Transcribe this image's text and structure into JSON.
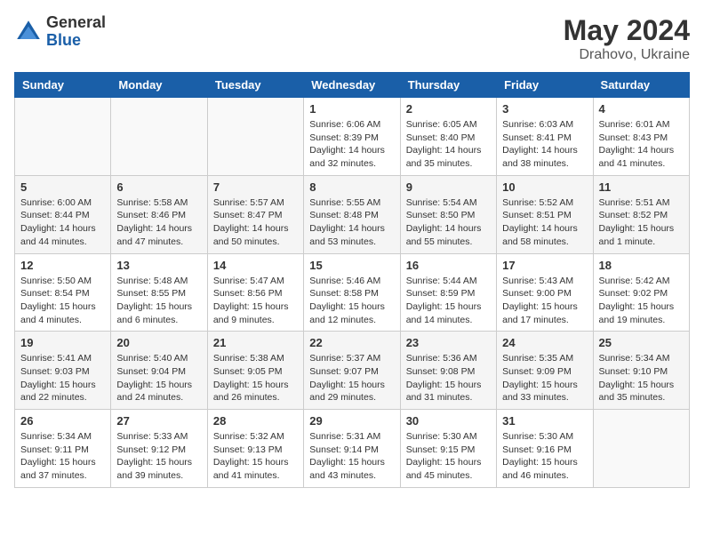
{
  "header": {
    "logo": {
      "general": "General",
      "blue": "Blue"
    },
    "title": "May 2024",
    "location": "Drahovo, Ukraine"
  },
  "weekdays": [
    "Sunday",
    "Monday",
    "Tuesday",
    "Wednesday",
    "Thursday",
    "Friday",
    "Saturday"
  ],
  "weeks": [
    [
      {
        "day": "",
        "info": ""
      },
      {
        "day": "",
        "info": ""
      },
      {
        "day": "",
        "info": ""
      },
      {
        "day": "1",
        "info": "Sunrise: 6:06 AM\nSunset: 8:39 PM\nDaylight: 14 hours\nand 32 minutes."
      },
      {
        "day": "2",
        "info": "Sunrise: 6:05 AM\nSunset: 8:40 PM\nDaylight: 14 hours\nand 35 minutes."
      },
      {
        "day": "3",
        "info": "Sunrise: 6:03 AM\nSunset: 8:41 PM\nDaylight: 14 hours\nand 38 minutes."
      },
      {
        "day": "4",
        "info": "Sunrise: 6:01 AM\nSunset: 8:43 PM\nDaylight: 14 hours\nand 41 minutes."
      }
    ],
    [
      {
        "day": "5",
        "info": "Sunrise: 6:00 AM\nSunset: 8:44 PM\nDaylight: 14 hours\nand 44 minutes."
      },
      {
        "day": "6",
        "info": "Sunrise: 5:58 AM\nSunset: 8:46 PM\nDaylight: 14 hours\nand 47 minutes."
      },
      {
        "day": "7",
        "info": "Sunrise: 5:57 AM\nSunset: 8:47 PM\nDaylight: 14 hours\nand 50 minutes."
      },
      {
        "day": "8",
        "info": "Sunrise: 5:55 AM\nSunset: 8:48 PM\nDaylight: 14 hours\nand 53 minutes."
      },
      {
        "day": "9",
        "info": "Sunrise: 5:54 AM\nSunset: 8:50 PM\nDaylight: 14 hours\nand 55 minutes."
      },
      {
        "day": "10",
        "info": "Sunrise: 5:52 AM\nSunset: 8:51 PM\nDaylight: 14 hours\nand 58 minutes."
      },
      {
        "day": "11",
        "info": "Sunrise: 5:51 AM\nSunset: 8:52 PM\nDaylight: 15 hours\nand 1 minute."
      }
    ],
    [
      {
        "day": "12",
        "info": "Sunrise: 5:50 AM\nSunset: 8:54 PM\nDaylight: 15 hours\nand 4 minutes."
      },
      {
        "day": "13",
        "info": "Sunrise: 5:48 AM\nSunset: 8:55 PM\nDaylight: 15 hours\nand 6 minutes."
      },
      {
        "day": "14",
        "info": "Sunrise: 5:47 AM\nSunset: 8:56 PM\nDaylight: 15 hours\nand 9 minutes."
      },
      {
        "day": "15",
        "info": "Sunrise: 5:46 AM\nSunset: 8:58 PM\nDaylight: 15 hours\nand 12 minutes."
      },
      {
        "day": "16",
        "info": "Sunrise: 5:44 AM\nSunset: 8:59 PM\nDaylight: 15 hours\nand 14 minutes."
      },
      {
        "day": "17",
        "info": "Sunrise: 5:43 AM\nSunset: 9:00 PM\nDaylight: 15 hours\nand 17 minutes."
      },
      {
        "day": "18",
        "info": "Sunrise: 5:42 AM\nSunset: 9:02 PM\nDaylight: 15 hours\nand 19 minutes."
      }
    ],
    [
      {
        "day": "19",
        "info": "Sunrise: 5:41 AM\nSunset: 9:03 PM\nDaylight: 15 hours\nand 22 minutes."
      },
      {
        "day": "20",
        "info": "Sunrise: 5:40 AM\nSunset: 9:04 PM\nDaylight: 15 hours\nand 24 minutes."
      },
      {
        "day": "21",
        "info": "Sunrise: 5:38 AM\nSunset: 9:05 PM\nDaylight: 15 hours\nand 26 minutes."
      },
      {
        "day": "22",
        "info": "Sunrise: 5:37 AM\nSunset: 9:07 PM\nDaylight: 15 hours\nand 29 minutes."
      },
      {
        "day": "23",
        "info": "Sunrise: 5:36 AM\nSunset: 9:08 PM\nDaylight: 15 hours\nand 31 minutes."
      },
      {
        "day": "24",
        "info": "Sunrise: 5:35 AM\nSunset: 9:09 PM\nDaylight: 15 hours\nand 33 minutes."
      },
      {
        "day": "25",
        "info": "Sunrise: 5:34 AM\nSunset: 9:10 PM\nDaylight: 15 hours\nand 35 minutes."
      }
    ],
    [
      {
        "day": "26",
        "info": "Sunrise: 5:34 AM\nSunset: 9:11 PM\nDaylight: 15 hours\nand 37 minutes."
      },
      {
        "day": "27",
        "info": "Sunrise: 5:33 AM\nSunset: 9:12 PM\nDaylight: 15 hours\nand 39 minutes."
      },
      {
        "day": "28",
        "info": "Sunrise: 5:32 AM\nSunset: 9:13 PM\nDaylight: 15 hours\nand 41 minutes."
      },
      {
        "day": "29",
        "info": "Sunrise: 5:31 AM\nSunset: 9:14 PM\nDaylight: 15 hours\nand 43 minutes."
      },
      {
        "day": "30",
        "info": "Sunrise: 5:30 AM\nSunset: 9:15 PM\nDaylight: 15 hours\nand 45 minutes."
      },
      {
        "day": "31",
        "info": "Sunrise: 5:30 AM\nSunset: 9:16 PM\nDaylight: 15 hours\nand 46 minutes."
      },
      {
        "day": "",
        "info": ""
      }
    ]
  ]
}
